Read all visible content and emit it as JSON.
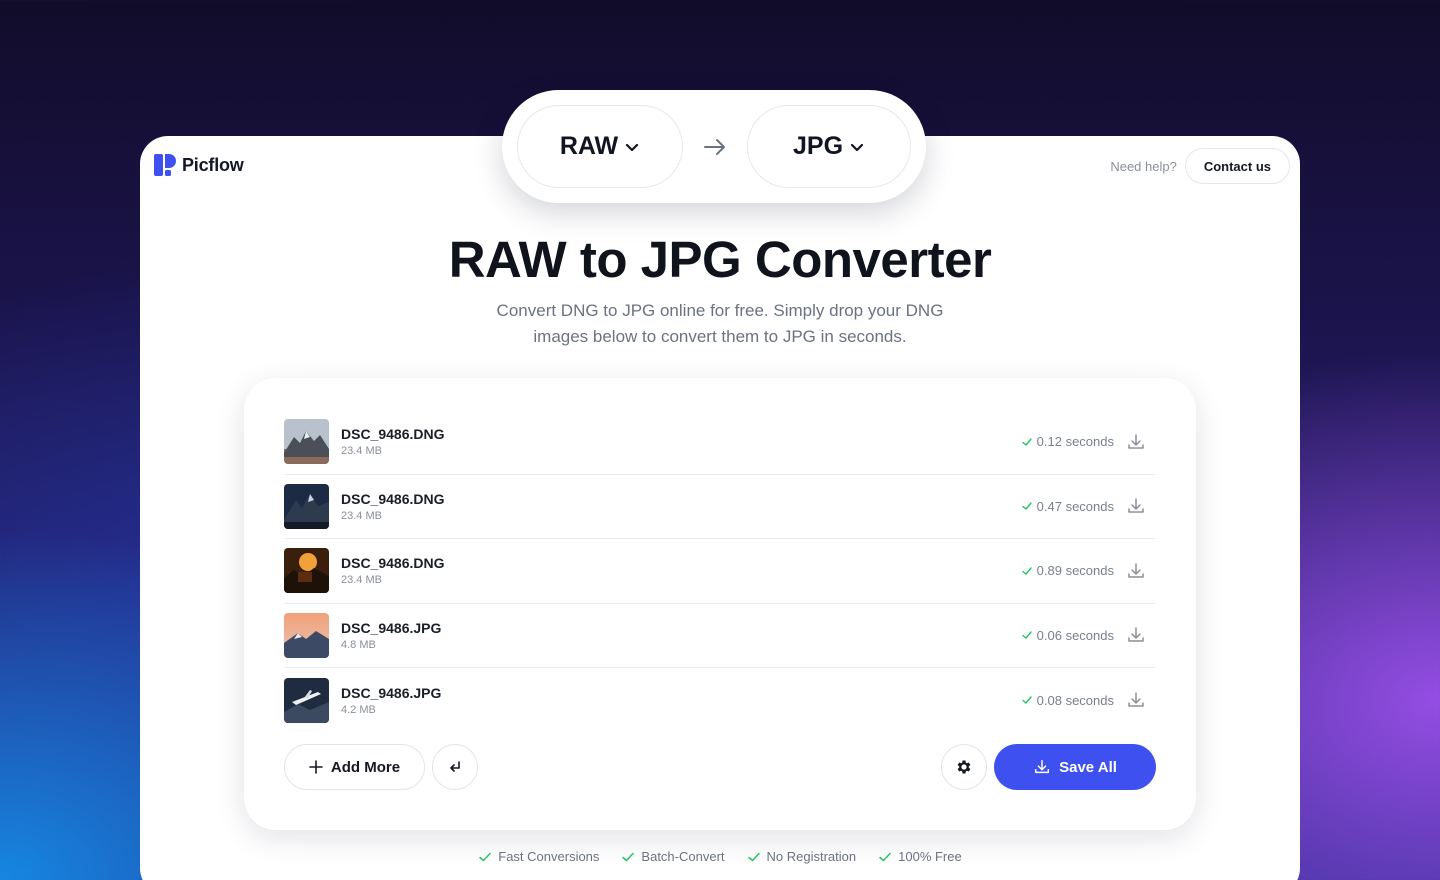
{
  "brand": {
    "name": "Picflow",
    "accent": "#3e51f0",
    "success": "#22c55e"
  },
  "header": {
    "help_text": "Need help?",
    "contact_label": "Contact us"
  },
  "switcher": {
    "from": "RAW",
    "to": "JPG"
  },
  "hero": {
    "title": "RAW to JPG Converter",
    "subtitle": "Convert DNG to JPG online for free. Simply drop your DNG images below to convert them to JPG in seconds."
  },
  "files": [
    {
      "name": "DSC_9486.DNG",
      "size": "23.4 MB",
      "status": "0.12 seconds",
      "thumb": "mountain-grey"
    },
    {
      "name": "DSC_9486.DNG",
      "size": "23.4 MB",
      "status": "0.47 seconds",
      "thumb": "mountain-night"
    },
    {
      "name": "DSC_9486.DNG",
      "size": "23.4 MB",
      "status": "0.89 seconds",
      "thumb": "sunset-dark"
    },
    {
      "name": "DSC_9486.JPG",
      "size": "4.8 MB",
      "status": "0.06 seconds",
      "thumb": "peach-mountain"
    },
    {
      "name": "DSC_9486.JPG",
      "size": "4.2 MB",
      "status": "0.08 seconds",
      "thumb": "airplane-sky"
    }
  ],
  "actions": {
    "add_more": "Add More",
    "save_all": "Save All"
  },
  "features": [
    "Fast Conversions",
    "Batch-Convert",
    "No Registration",
    "100% Free"
  ]
}
